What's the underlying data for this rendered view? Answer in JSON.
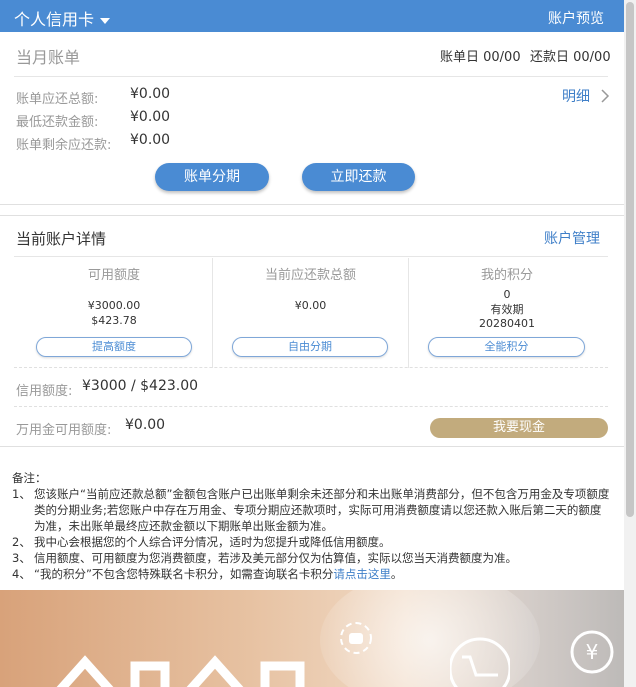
{
  "header": {
    "title": "个人信用卡",
    "preview_link": "账户预览"
  },
  "bill": {
    "section_title": "当月账单",
    "bill_day": "账单日 00/00",
    "due_day": "还款日 00/00",
    "rows": [
      {
        "label": "账单应还总额:",
        "value": "¥0.00"
      },
      {
        "label": "最低还款金额:",
        "value": "¥0.00"
      },
      {
        "label": "账单剩余应还款:",
        "value": "¥0.00"
      }
    ],
    "detail_link": "明细",
    "installment_button": "账单分期",
    "repay_button": "立即还款"
  },
  "account": {
    "section_title": "当前账户详情",
    "manage_link": "账户管理",
    "columns": [
      {
        "head": "可用额度",
        "lines": [
          "¥3000.00",
          "$423.78"
        ],
        "button": "提高额度"
      },
      {
        "head": "当前应还款总额",
        "lines": [
          "¥0.00"
        ],
        "button": "自由分期"
      },
      {
        "head": "我的积分",
        "lines": [
          "0",
          "有效期",
          "20280401"
        ],
        "button": "全能积分"
      }
    ],
    "credit_limit_label": "信用额度:",
    "credit_limit_value": "¥3000 / $423.00",
    "wanyong_label": "万用金可用额度:",
    "wanyong_value": "¥0.00",
    "cash_button": "我要现金"
  },
  "notes": {
    "title": "备注：",
    "items": [
      {
        "num": "1、",
        "text": "您该账户“当前应还款总额”金额包含账户已出账单剩余未还部分和未出账单消费部分，但不包含万用金及专项额度类的分期业务;若您账户中存在万用金、专项分期应还款项时，实际可用消费额度请以您还款入账后第二天的额度为准，未出账单最终应还款金额以下期账单出账金额为准。"
      },
      {
        "num": "2、",
        "text": "我中心会根据您的个人综合评分情况，适时为您提升或降低信用额度。"
      },
      {
        "num": "3、",
        "text": "信用额度、可用额度为您消费额度，若涉及美元部分仅为估算值，实际以您当天消费额度为准。"
      },
      {
        "num": "4、",
        "text": "“我的积分”不包含您特殊联名卡积分，如需查询联名卡积分",
        "link": "请点击这里",
        "tail": "。"
      }
    ]
  },
  "colors": {
    "primary": "#4a8bd3",
    "gold": "#c2ab7d",
    "link": "#3f7fc8"
  },
  "icons": [
    "caret-down-icon",
    "chevron-right-icon",
    "money-bag-icon",
    "cart-icon",
    "yen-icon"
  ]
}
